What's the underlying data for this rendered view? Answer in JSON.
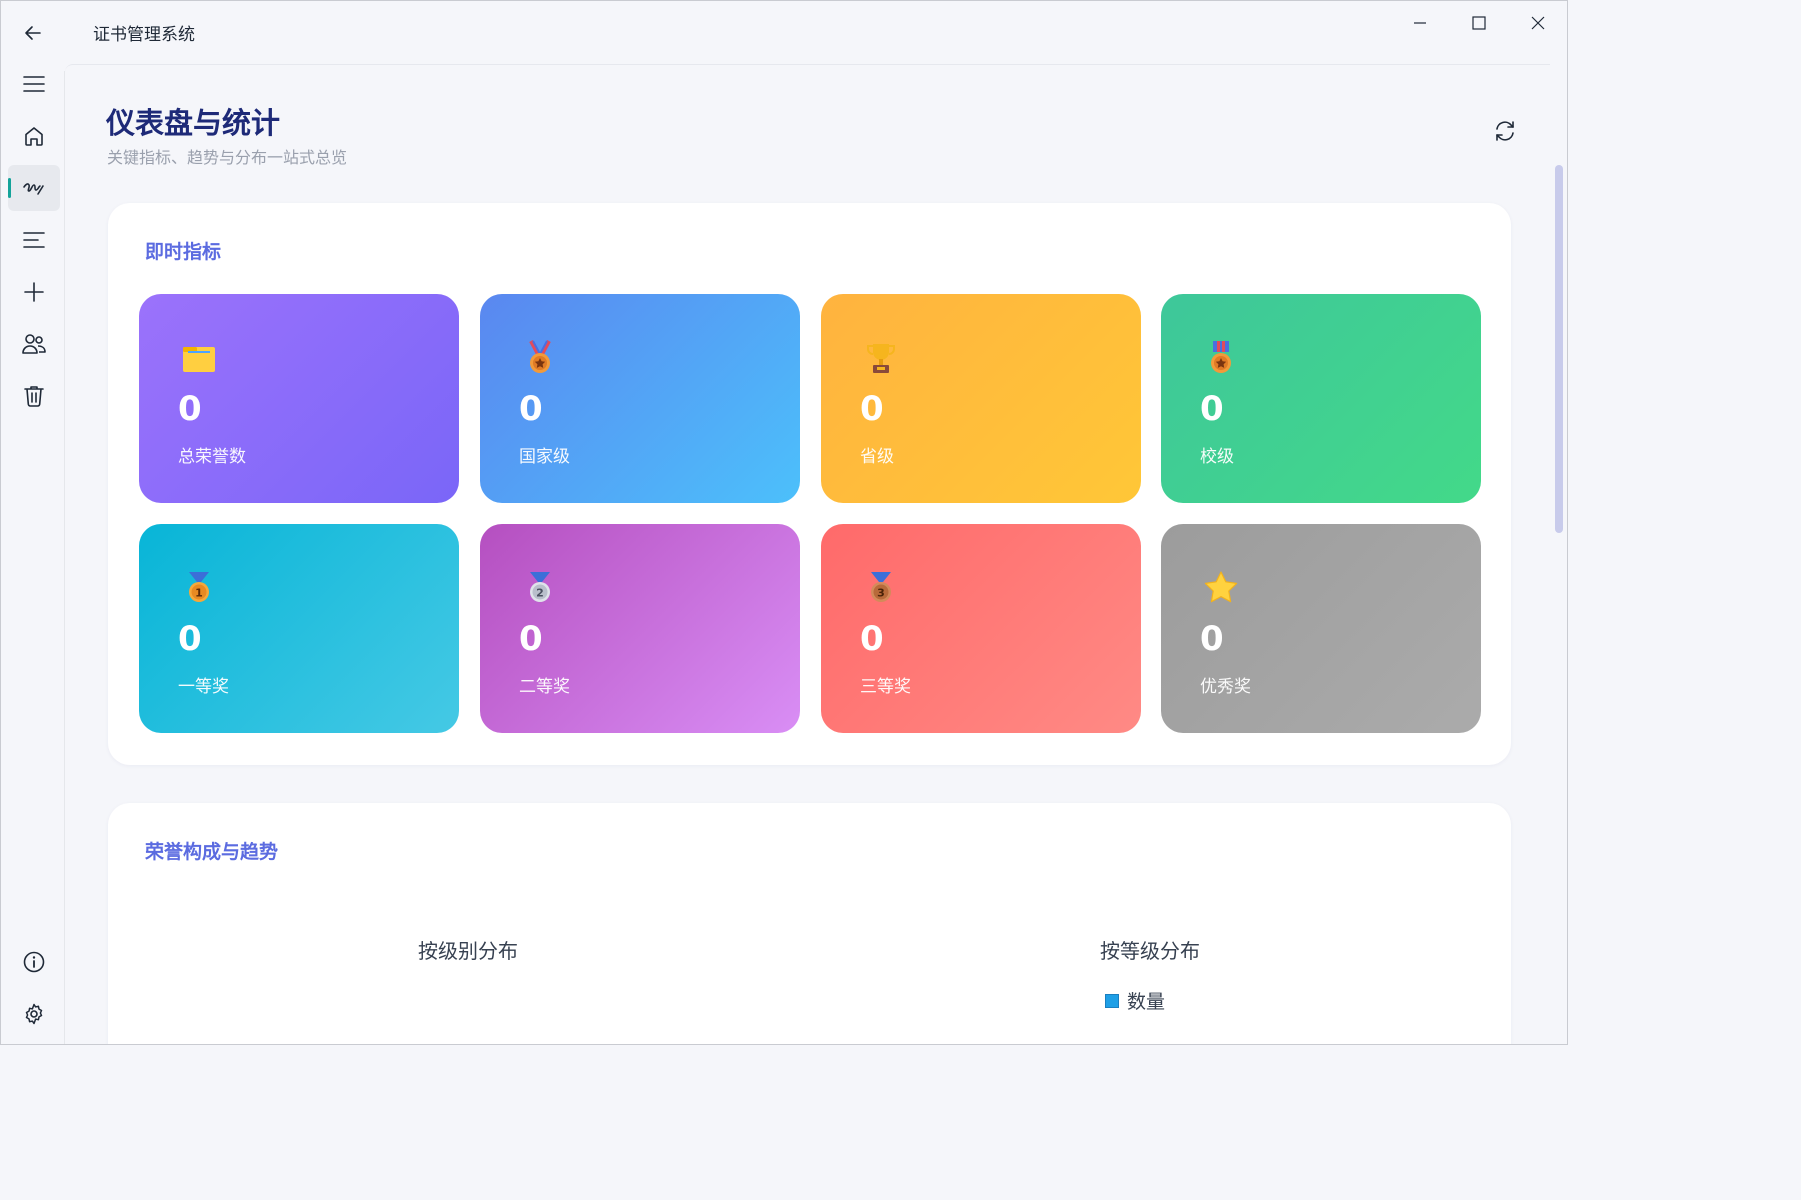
{
  "window": {
    "title": "证书管理系统",
    "controls": [
      "minimize-icon",
      "maximize-icon",
      "close-icon"
    ]
  },
  "sidebar": {
    "items": [
      {
        "name": "menu",
        "icon": "hamburger-icon",
        "active": false
      },
      {
        "name": "home",
        "icon": "home-icon",
        "active": false
      },
      {
        "name": "dashboard",
        "icon": "signature-icon",
        "active": true
      },
      {
        "name": "list",
        "icon": "list-icon",
        "active": false
      },
      {
        "name": "add",
        "icon": "plus-icon",
        "active": false
      },
      {
        "name": "users",
        "icon": "users-icon",
        "active": false
      },
      {
        "name": "trash",
        "icon": "trash-icon",
        "active": false
      }
    ],
    "bottom": [
      {
        "name": "info",
        "icon": "info-icon"
      },
      {
        "name": "settings",
        "icon": "gear-icon"
      }
    ],
    "accent": "#14a39a"
  },
  "header": {
    "title": "仪表盘与统计",
    "subtitle": "关键指标、趋势与分布一站式总览"
  },
  "metrics": {
    "section_title": "即时指标",
    "tiles": [
      {
        "label": "总荣誉数",
        "value": "0",
        "icon": "folder-icon",
        "gradient": [
          "#9b72fb",
          "#7a66f8"
        ]
      },
      {
        "label": "国家级",
        "value": "0",
        "icon": "medal-icon",
        "gradient": [
          "#5a87f0",
          "#4cc0fb"
        ]
      },
      {
        "label": "省级",
        "value": "0",
        "icon": "trophy-icon",
        "gradient": [
          "#ffb33f",
          "#ffc737"
        ]
      },
      {
        "label": "校级",
        "value": "0",
        "icon": "badge-medal-icon",
        "gradient": [
          "#3ec79a",
          "#43d989"
        ]
      },
      {
        "label": "一等奖",
        "value": "0",
        "icon": "first-place-medal-icon",
        "gradient": [
          "#08b5d7",
          "#45c9e5"
        ]
      },
      {
        "label": "二等奖",
        "value": "0",
        "icon": "second-place-medal-icon",
        "gradient": [
          "#b54fc0",
          "#d98ef5"
        ]
      },
      {
        "label": "三等奖",
        "value": "0",
        "icon": "third-place-medal-icon",
        "gradient": [
          "#ff6a6a",
          "#ff8a85"
        ]
      },
      {
        "label": "优秀奖",
        "value": "0",
        "icon": "star-icon",
        "gradient": [
          "#9c9c9c",
          "#ababab"
        ]
      }
    ]
  },
  "charts": {
    "section_title": "荣誉构成与趋势",
    "left_title": "按级别分布",
    "right_title": "按等级分布",
    "legend_label": "数量"
  }
}
